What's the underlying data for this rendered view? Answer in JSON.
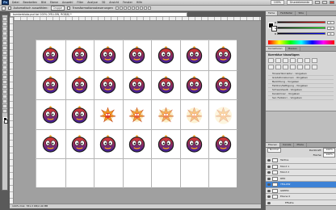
{
  "app": {
    "logo": "Ps",
    "menu": [
      "Datei",
      "Bearbeiten",
      "Bild",
      "Ebene",
      "Auswahl",
      "Filter",
      "Analyse",
      "3D",
      "Ansicht",
      "Fenster",
      "Hilfe"
    ],
    "zoom": "100%",
    "workspace": "Grundelemente"
  },
  "options": {
    "auto_select_label": "Automatisch auswählen:",
    "auto_select_value": "Gruppe",
    "transform_label": "Transformationssteuerungen"
  },
  "document": {
    "tab_title": "bomberblobs.psd bei 100% (YELLOW, RGB/8) *",
    "status": "100%   Dok: 781,3 KB/2,49 MB"
  },
  "panels": {
    "color_tabs": [
      "Farbe",
      "Farbfelder",
      "Stile"
    ],
    "rgb": [
      {
        "label": "R",
        "value": "0"
      },
      {
        "label": "G",
        "value": "0"
      },
      {
        "label": "B",
        "value": "0"
      }
    ],
    "adjust_tabs": [
      "Korrekturen",
      "Masken"
    ],
    "adjust_title": "Korrektur hinzufügen",
    "presets": [
      "Tonwertkorrektur - Vorgaben",
      "Gradationskurven - Vorgaben",
      "Belichtung - Vorgaben",
      "Farbton/Sättigung - Vorgaben",
      "Schwarzweiß - Vorgaben",
      "Kanalmixer - Vorgaben",
      "Sel. Farbkorr. - Vorgaben"
    ],
    "layer_tabs": [
      "Ebenen",
      "Kanäle",
      "Pfade"
    ],
    "blend_mode": "Normal",
    "opacity_label": "Deckkraft:",
    "opacity": "100%",
    "fill_label": "Fläche:",
    "fill": "100%",
    "layers": [
      {
        "name": "Taktlos",
        "selected": false,
        "indent": false
      },
      {
        "name": "Mond 1",
        "selected": false,
        "indent": false
      },
      {
        "name": "Mond 2",
        "selected": false,
        "indent": false
      },
      {
        "name": "RED",
        "selected": false,
        "indent": false
      },
      {
        "name": "YELLOW",
        "selected": true,
        "indent": false
      },
      {
        "name": "GREEN",
        "selected": false,
        "indent": false
      },
      {
        "name": "Ebene 0",
        "selected": false,
        "indent": false
      },
      {
        "name": "Effekte",
        "selected": false,
        "indent": true
      },
      {
        "name": "Musterüberlagerung",
        "selected": false,
        "indent": true
      }
    ]
  },
  "sprites": {
    "rows": [
      [
        "blob",
        "blob",
        "blob",
        "blob",
        "blob",
        "blob",
        "blob"
      ],
      [
        "blob",
        "blob",
        "blob",
        "blob",
        "blob",
        "blob",
        "blob"
      ],
      [
        "blob",
        "blob",
        "explode1",
        "explode2",
        "explode3",
        "explode4",
        "explode5"
      ],
      [
        "blob",
        "blob",
        "blob",
        "blob",
        "blob",
        "blob",
        "blob"
      ],
      [
        "empty",
        "empty",
        "empty",
        "empty",
        "empty",
        "empty",
        "empty"
      ]
    ],
    "colors": {
      "body_top": "#e23b2c",
      "body_bottom": "#3a1f9e",
      "outline": "#1a1a1a",
      "fire": "#f7a21b",
      "eye": "#ffffff"
    }
  }
}
